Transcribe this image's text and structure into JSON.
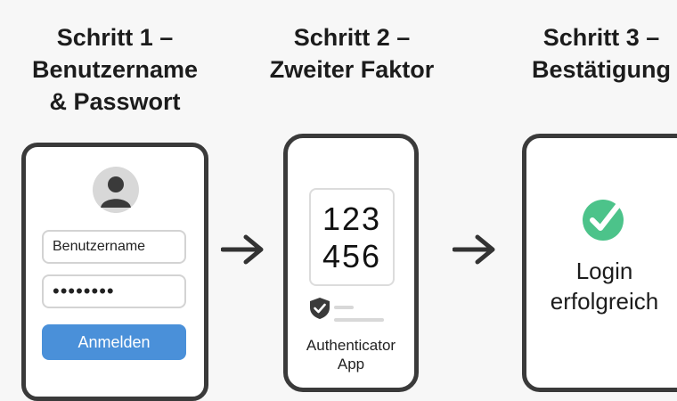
{
  "steps": [
    {
      "title": "Schritt 1 –\nBenutzername\n& Passwort"
    },
    {
      "title": "Schritt 2 –\nZweiter Faktor"
    },
    {
      "title": "Schritt 3 –\nBestätigung"
    }
  ],
  "login_form": {
    "username_value": "Benutzername",
    "password_value": "••••••••",
    "submit_label": "Anmelden"
  },
  "authenticator": {
    "code_line1": "123",
    "code_line2": "456",
    "app_label": "Authenticator\nApp"
  },
  "confirmation": {
    "message": "Login\nerfolgreich"
  },
  "icons": {
    "avatar": "user-avatar-icon",
    "shield": "shield-check-icon",
    "success": "checkmark-circle-icon",
    "arrow": "arrow-right-icon"
  },
  "colors": {
    "button": "#4a90d9",
    "success": "#4cc38a"
  }
}
